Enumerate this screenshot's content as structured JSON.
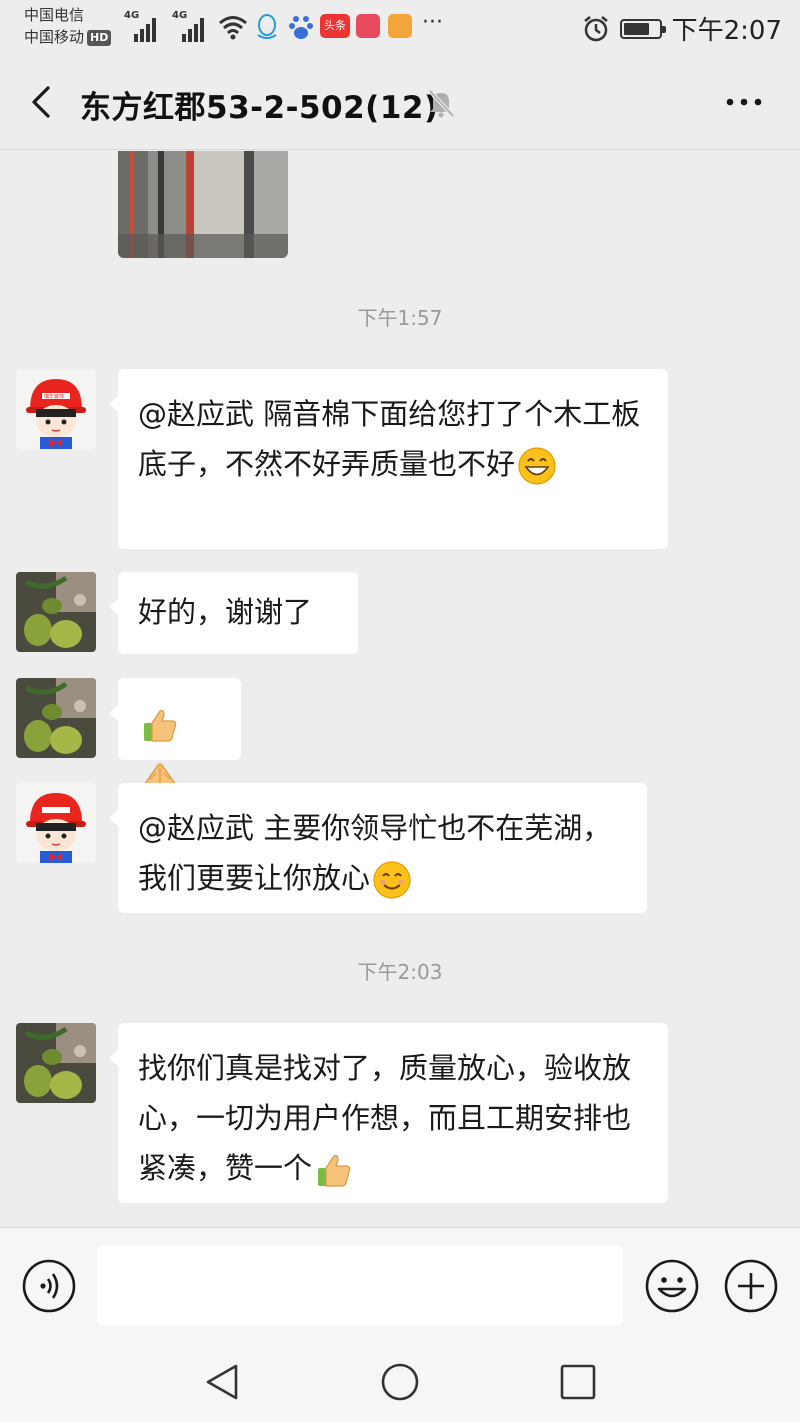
{
  "status_bar": {
    "carriers": [
      "中国电信",
      "中国移动"
    ],
    "hd_badge": "HD",
    "network_labels": [
      "4G",
      "4G"
    ],
    "app_badges": [
      "头条"
    ],
    "more_dots": "···",
    "time": "下午2:07",
    "battery_level": 0.75
  },
  "header": {
    "title": "东方红郡53-2-502(12)",
    "muted": true
  },
  "chat": {
    "timestamps": [
      "下午1:57",
      "下午2:03"
    ],
    "messages": [
      {
        "sender": "helmet-avatar",
        "text": "@赵应武  隔音棉下面给您打了个木工板底子，不然不好弄质量也不好",
        "emoji": "grin-emoji"
      },
      {
        "sender": "fruit-avatar",
        "text": "好的，谢谢了",
        "emoji": ""
      },
      {
        "sender": "fruit-avatar",
        "text": "",
        "emoji": "thumbs-up-and-handshake"
      },
      {
        "sender": "helmet-avatar",
        "text": "@赵应武  主要你领导忙也不在芜湖，我们更要让你放心",
        "emoji": "smile-emoji"
      },
      {
        "sender": "fruit-avatar",
        "text": "找你们真是找对了，质量放心，验收放心，一切为用户作想，而且工期安排也紧凑，赞一个",
        "emoji": "thumbs-up-emoji"
      }
    ],
    "avatar_badge": "瑞华装饰"
  },
  "input": {
    "placeholder": "",
    "value": ""
  },
  "colors": {
    "background": "#ededed",
    "bubble": "#ffffff",
    "timestamp": "#9a9a9a",
    "helmet_red": "#e8261f"
  }
}
